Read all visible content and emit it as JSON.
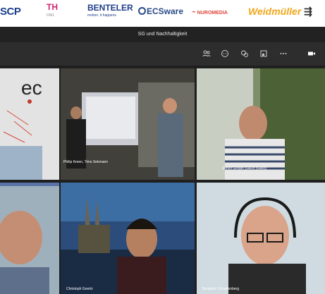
{
  "logos": {
    "scp": "SCP",
    "th": "TH",
    "th_sub": "OWL",
    "benteler": "BENTELER",
    "benteler_sub": "motion. it happens",
    "ecs": "ECSware",
    "nuromedia": "NUROMEDIA",
    "weidmueller": "Weidmüller"
  },
  "meeting": {
    "title": "SG und Nachhaltigkeit"
  },
  "participants": [
    {
      "name": "Philip Kreen, Timo Sekmann"
    },
    {
      "name": "Simon Gröger (GEDI (Gast))"
    },
    {
      "name": "Christoph Goertz"
    },
    {
      "name": "Benjamin Schattenberg"
    }
  ],
  "tile1_text": "ec",
  "colors": {
    "teams_bar": "#222222",
    "toolbar": "#2d2d2d",
    "weidmueller": "#f0a81c"
  }
}
